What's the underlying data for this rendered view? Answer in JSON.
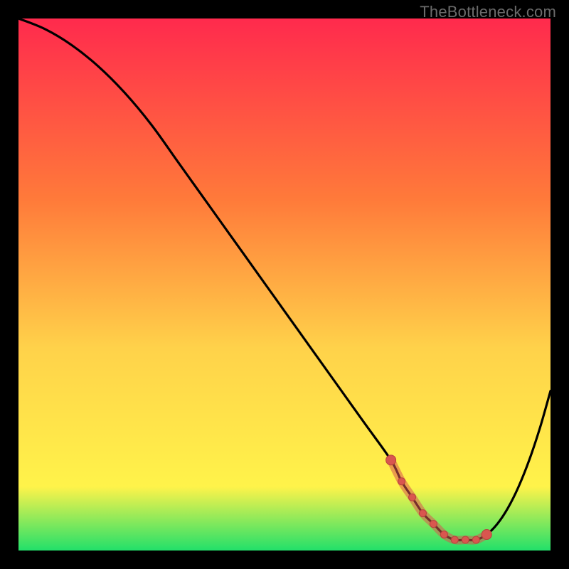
{
  "watermark": "TheBottleneck.com",
  "colors": {
    "background": "#000000",
    "gradient_top": "#ff2a4d",
    "gradient_mid1": "#ff7a3a",
    "gradient_mid2": "#ffd24a",
    "gradient_mid3": "#fff34a",
    "gradient_bottom": "#22e06a",
    "curve": "#000000",
    "marker_fill": "#d9564f",
    "marker_stroke": "#b8423c"
  },
  "chart_data": {
    "type": "line",
    "title": "",
    "xlabel": "",
    "ylabel": "",
    "xlim": [
      0,
      100
    ],
    "ylim": [
      0,
      100
    ],
    "grid": false,
    "legend": false,
    "series": [
      {
        "name": "bottleneck-curve",
        "x": [
          0,
          5,
          10,
          15,
          20,
          25,
          30,
          35,
          40,
          45,
          50,
          55,
          60,
          65,
          70,
          72,
          74,
          76,
          78,
          80,
          82,
          84,
          86,
          88,
          90,
          92,
          94,
          96,
          98,
          100
        ],
        "values": [
          100,
          98,
          95,
          91,
          86,
          80,
          73,
          66,
          59,
          52,
          45,
          38,
          31,
          24,
          17,
          13,
          10,
          7,
          5,
          3,
          2,
          2,
          2,
          3,
          5,
          8,
          12,
          17,
          23,
          30
        ]
      }
    ],
    "markers": {
      "name": "optimal-range",
      "x": [
        70,
        72,
        74,
        76,
        78,
        80,
        82,
        84,
        86,
        88
      ],
      "values": [
        17,
        13,
        10,
        7,
        5,
        3,
        2,
        2,
        2,
        3
      ]
    }
  }
}
